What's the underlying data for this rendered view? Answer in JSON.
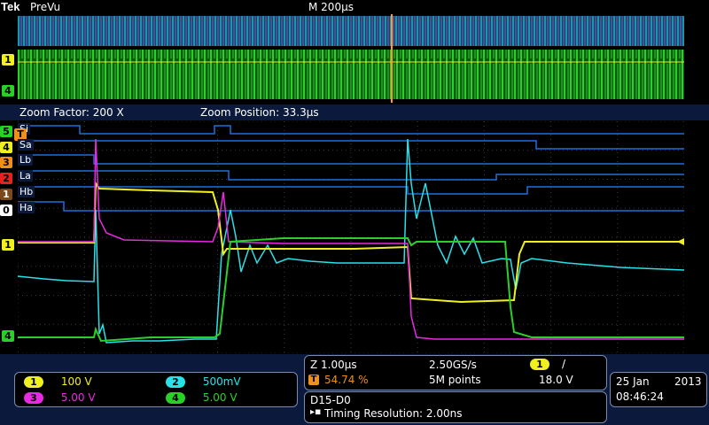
{
  "header": {
    "brand": "Tek",
    "mode": "PreVu",
    "timebase": "M 200µs",
    "trigger_marker": "T"
  },
  "zoom": {
    "factor": "Zoom Factor: 200 X",
    "position": "Zoom Position: 33.3µs"
  },
  "left_markers": {
    "overview_ch1": "1",
    "overview_ch4": "4",
    "ch1": "1",
    "ch4": "4"
  },
  "digital_labels": [
    {
      "num": "5",
      "name": "Si"
    },
    {
      "num": "4",
      "name": "Sa"
    },
    {
      "num": "3",
      "name": "Lb"
    },
    {
      "num": "2",
      "name": "La"
    },
    {
      "num": "1",
      "name": "Hb"
    },
    {
      "num": "0",
      "name": "Ha"
    }
  ],
  "channels": [
    {
      "num": "1",
      "scale": "100 V",
      "color": "#f0f020"
    },
    {
      "num": "2",
      "scale": "500mV",
      "color": "#29e1e9"
    },
    {
      "num": "3",
      "scale": "5.00 V",
      "color": "#e82ae0"
    },
    {
      "num": "4",
      "scale": "5.00 V",
      "color": "#2ad02a"
    }
  ],
  "acquisition": {
    "horizontal": "Z 1.00µs",
    "sample_rate": "2.50GS/s",
    "trigger_source": "1",
    "trigger_slope": "/",
    "trigger_position": "54.74 %",
    "record_length": "5M points",
    "trigger_level": "18.0 V"
  },
  "digital_info": {
    "group": "D15-D0",
    "timing": "Timing Resolution: 2.00ns"
  },
  "datetime": {
    "date_day": "25 Jan",
    "year": "2013",
    "time": "08:46:24"
  },
  "colors": {
    "ch1": "#f0f020",
    "ch2": "#29e1e9",
    "ch3": "#e82ae0",
    "ch4": "#2ad02a",
    "trigger": "#f0901a",
    "digital": "#1e6fd8"
  }
}
